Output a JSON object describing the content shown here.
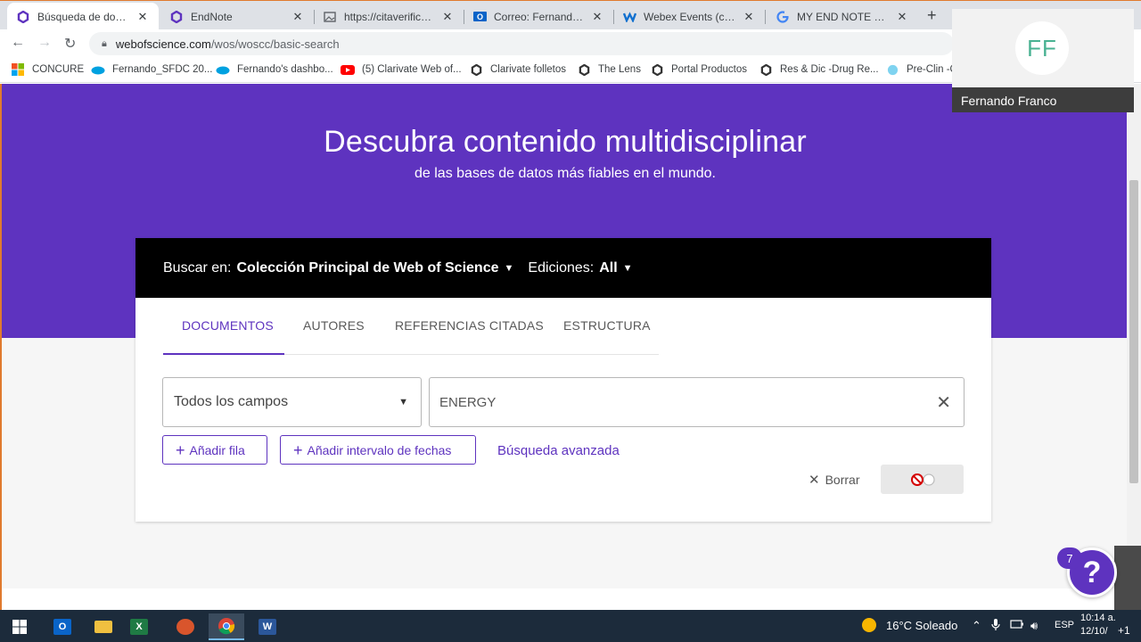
{
  "browser": {
    "tabs": [
      {
        "title": "Búsqueda de documentos",
        "favicon": "clarivate-icon",
        "active": true
      },
      {
        "title": "EndNote",
        "favicon": "clarivate-icon",
        "active": false
      },
      {
        "title": "https://citaverificacion...",
        "favicon": "image-icon",
        "active": false
      },
      {
        "title": "Correo: Fernando fran...",
        "favicon": "outlook-icon",
        "active": false
      },
      {
        "title": "Webex Events (classic)",
        "favicon": "webex-icon",
        "active": false
      },
      {
        "title": "MY END NOTE WEB -",
        "favicon": "google-icon",
        "active": false
      }
    ],
    "new_tab": "+",
    "url_host": "webofscience.com",
    "url_path": "/wos/woscc/basic-search",
    "bookmarks": [
      {
        "label": "CONCURE",
        "icon": "windows-grid-icon"
      },
      {
        "label": "Fernando_SFDC 20...",
        "icon": "salesforce-cloud-icon"
      },
      {
        "label": "Fernando's dashbo...",
        "icon": "salesforce-cloud-icon"
      },
      {
        "label": "(5) Clarivate Web of...",
        "icon": "youtube-icon"
      },
      {
        "label": "Clarivate folletos",
        "icon": "clarivate-icon"
      },
      {
        "label": "The Lens",
        "icon": "clarivate-icon"
      },
      {
        "label": "Portal Productos",
        "icon": "clarivate-icon"
      },
      {
        "label": "Res & Dic -Drug Re...",
        "icon": "clarivate-icon"
      },
      {
        "label": "Pre-Clin -C",
        "icon": "globe-icon"
      }
    ]
  },
  "hero": {
    "title": "Descubra contenido multidisciplinar",
    "subtitle": "de las bases de datos más fiables en el mundo."
  },
  "search": {
    "search_in_label": "Buscar en:",
    "collection": "Colección Principal de Web of Science",
    "editions_label": "Ediciones:",
    "editions_value": "All",
    "tabs": [
      "DOCUMENTOS",
      "AUTORES",
      "REFERENCIAS CITADAS",
      "ESTRUCTURA"
    ],
    "field_select": "Todos los campos",
    "query": "ENERGY",
    "add_row": "Añadir fila",
    "add_date_range": "Añadir intervalo de fechas",
    "advanced": "Búsqueda avanzada",
    "clear": "Borrar"
  },
  "help": {
    "badge": "7",
    "icon": "?"
  },
  "video": {
    "initials": "FF",
    "name": "Fernando Franco"
  },
  "taskbar": {
    "weather": "16°C  Soleado",
    "lang": "ESP",
    "time": "10:14 a.",
    "date": "12/10/",
    "notify": "+1"
  },
  "colors": {
    "brand_purple": "#5e33bf",
    "header_black": "#000000"
  }
}
